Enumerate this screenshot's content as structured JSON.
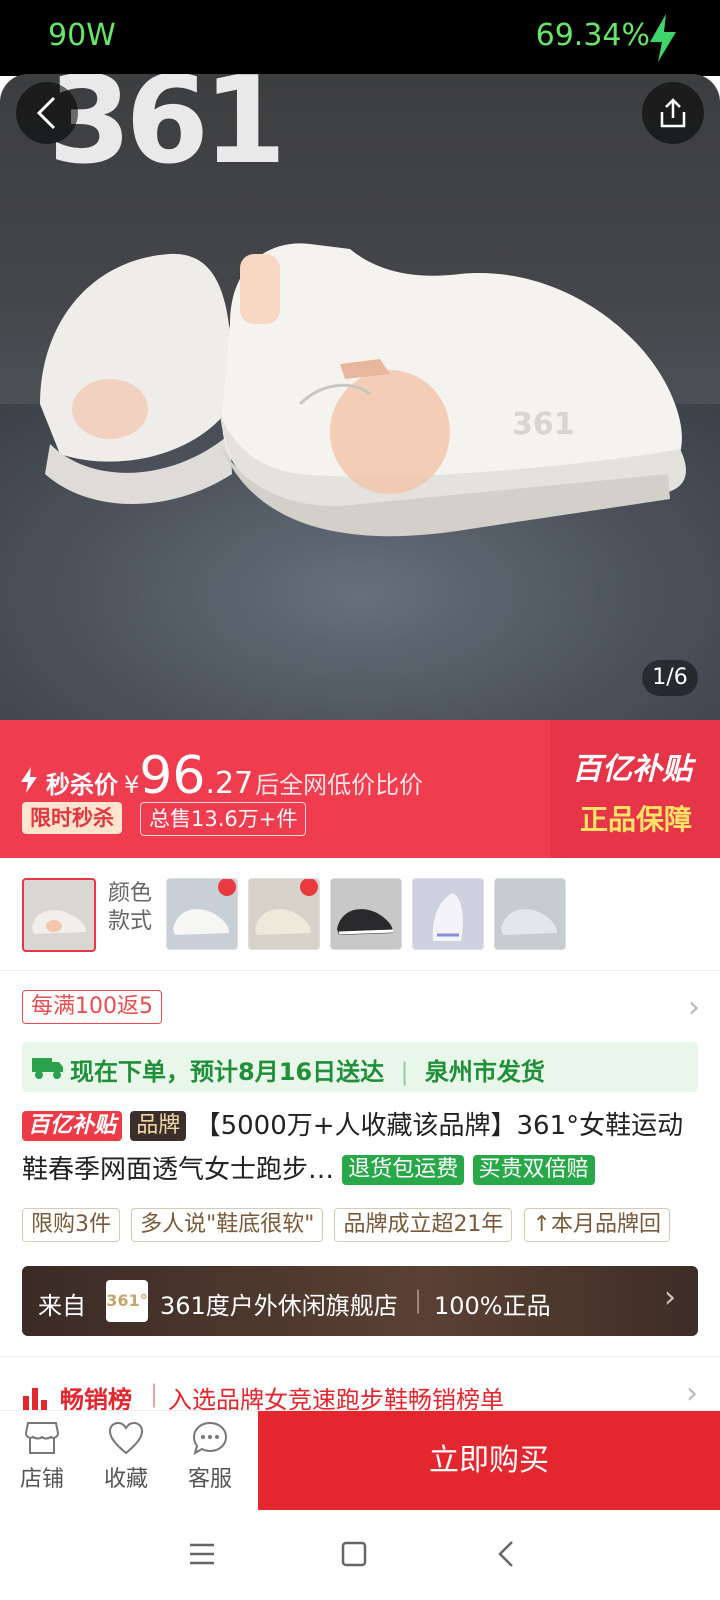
{
  "status_bar": {
    "left": "90W",
    "right": "69.34%"
  },
  "hero": {
    "logo_text": "361",
    "counter": "1/6"
  },
  "price": {
    "label": "秒杀价",
    "currency": "¥",
    "integer": "96",
    "decimal": ".27",
    "note": "后全网低价比价",
    "tags": [
      "限时秒杀",
      "总售13.6万+件"
    ],
    "subsidy": "百亿补贴",
    "guarantee": "正品保障"
  },
  "color_section": {
    "label1": "颜色",
    "label2": "款式"
  },
  "coupon": {
    "text": "每满100返5"
  },
  "delivery": {
    "text": "现在下单，预计8月16日送达",
    "origin": "泉州市发货"
  },
  "product": {
    "badge_subsidy": "百亿补贴",
    "badge_brand": "品牌",
    "title": "【5000万+人收藏该品牌】361°女鞋运动鞋春季网面透气女士跑步…",
    "badge_return": "退货包运费",
    "badge_expensive": "买贵双倍赔",
    "tags": [
      "限购3件",
      "多人说\"鞋底很软\"",
      "品牌成立超21年",
      "本月品牌回"
    ]
  },
  "store": {
    "from": "来自",
    "logo": "361°",
    "name": "361度户外休闲旗舰店",
    "authentic": "100%正品"
  },
  "bestseller": {
    "title": "畅销榜",
    "text": "入选品牌女竞速跑步鞋畅销榜单"
  },
  "bottom_bar": {
    "shop": "店铺",
    "favorite": "收藏",
    "service": "客服",
    "buy": "立即购买"
  },
  "colors": {
    "accent": "#e4262f",
    "banner": "#ef3d4f",
    "green": "#1f8f38"
  }
}
